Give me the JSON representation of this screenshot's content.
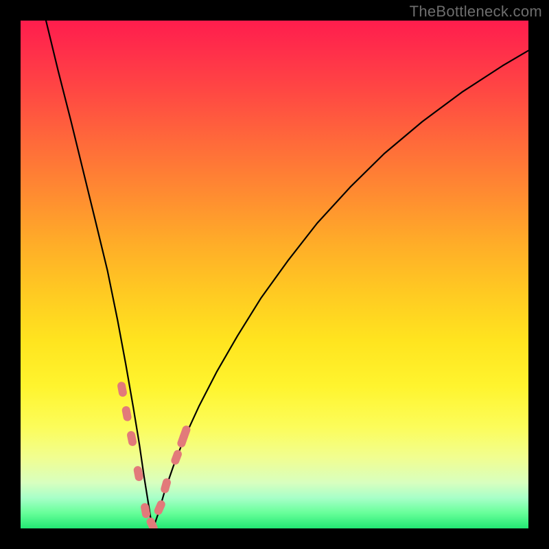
{
  "watermark": "TheBottleneck.com",
  "chart_data": {
    "type": "line",
    "title": "",
    "xlabel": "",
    "ylabel": "",
    "xlim": [
      0,
      100
    ],
    "ylim": [
      0,
      100
    ],
    "background_gradient_stops": [
      {
        "pos": 0,
        "color": "#ff1d4d"
      },
      {
        "pos": 24,
        "color": "#ff6a3a"
      },
      {
        "pos": 54,
        "color": "#ffcb22"
      },
      {
        "pos": 80,
        "color": "#fcfd5a"
      },
      {
        "pos": 100,
        "color": "#22e873"
      }
    ],
    "series": [
      {
        "name": "curve",
        "color": "#000000",
        "x": [
          5.0,
          7.4,
          9.9,
          12.3,
          14.7,
          17.1,
          19.1,
          20.7,
          22.2,
          23.4,
          24.3,
          25.1,
          25.7,
          26.1,
          27.1,
          28.4,
          30.1,
          32.2,
          35.1,
          38.6,
          42.7,
          47.3,
          52.7,
          58.4,
          64.9,
          71.6,
          79.1,
          86.9,
          94.9,
          100.0
        ],
        "y": [
          100.0,
          90.1,
          80.3,
          70.5,
          60.7,
          50.8,
          41.0,
          32.4,
          23.8,
          16.5,
          10.3,
          5.3,
          1.5,
          0.0,
          2.9,
          7.4,
          12.3,
          17.7,
          24.0,
          30.8,
          37.9,
          45.3,
          52.8,
          60.1,
          67.2,
          73.8,
          80.1,
          85.9,
          91.1,
          94.1
        ]
      },
      {
        "name": "markers",
        "color": "#e27a7a",
        "type": "scatter",
        "x": [
          20.0,
          20.9,
          21.9,
          23.2,
          24.6,
          25.9,
          27.4,
          28.6,
          30.7,
          31.9,
          32.4
        ],
        "y": [
          27.4,
          22.6,
          17.7,
          10.8,
          3.5,
          0.7,
          4.1,
          8.4,
          14.0,
          17.4,
          18.8
        ]
      }
    ]
  }
}
